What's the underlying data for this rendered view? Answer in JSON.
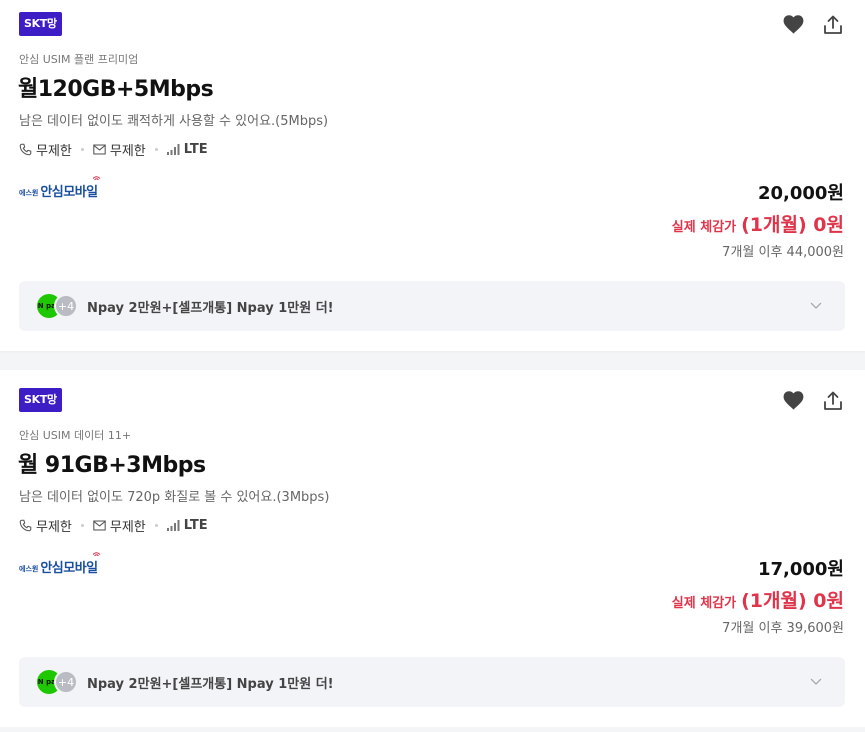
{
  "cards": [
    {
      "badge": "SKT망",
      "subtitle": "안심 USIM 플랜 프리미엄",
      "title": "월120GB+5Mbps",
      "description": "남은 데이터 없이도 쾌적하게 사용할 수 있어요.(5Mbps)",
      "call": "무제한",
      "sms": "무제한",
      "network": "LTE",
      "carrier_prefix": "에스원",
      "carrier_name": "안심모바일",
      "price": "20,000원",
      "promo_label": "실제 체감가",
      "promo_value": "(1개월) 0원",
      "after_price": "7개월 이후 44,000원",
      "benefit_coin_label": "N pay",
      "benefit_more": "+4",
      "benefit_text": "Npay 2만원+[셀프개통] Npay 1만원 더!"
    },
    {
      "badge": "SKT망",
      "subtitle": "안심 USIM 데이터 11+",
      "title": "월 91GB+3Mbps",
      "description": "남은 데이터 없이도 720p 화질로 볼 수 있어요.(3Mbps)",
      "call": "무제한",
      "sms": "무제한",
      "network": "LTE",
      "carrier_prefix": "에스원",
      "carrier_name": "안심모바일",
      "price": "17,000원",
      "promo_label": "실제 체감가",
      "promo_value": "(1개월) 0원",
      "after_price": "7개월 이후 39,600원",
      "benefit_coin_label": "N pay",
      "benefit_more": "+4",
      "benefit_text": "Npay 2만원+[셀프개통] Npay 1만원 더!"
    }
  ],
  "icons": {
    "favorite": "heart-icon",
    "share": "share-icon",
    "call": "phone-icon",
    "sms": "envelope-icon",
    "network": "signal-icon",
    "expand": "chevron-down-icon"
  },
  "colors": {
    "badge": "#3d1dc5",
    "promo": "#e0344b",
    "npay": "#1ec800",
    "carrier": "#1a4fa0"
  }
}
